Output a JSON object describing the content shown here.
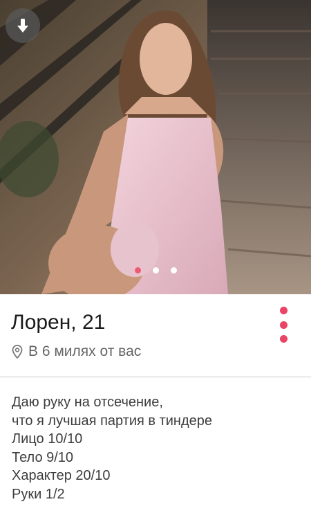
{
  "profile": {
    "name_age": "Лорен, 21",
    "distance": "В 6 милях от вас",
    "bio_lines": [
      "Даю руку на отсечение,",
      "что я лучшая партия в тиндере",
      "Лицо 10/10",
      "Тело 9/10",
      "Характер 20/10",
      "Руки 1/2"
    ]
  },
  "photo": {
    "count": 3,
    "active_index": 0
  },
  "icons": {
    "download": "arrow-down-icon",
    "menu": "vertical-dots-icon",
    "location": "location-pin-icon"
  },
  "colors": {
    "accent": "#ea4466",
    "text": "#1a1a1a",
    "muted": "#666666"
  }
}
